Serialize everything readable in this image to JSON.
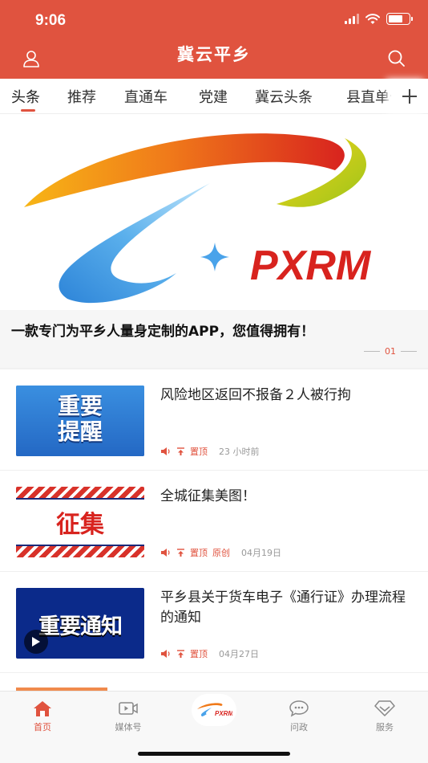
{
  "status": {
    "time": "9:06"
  },
  "header": {
    "title": "冀云平乡"
  },
  "tabs": [
    {
      "label": "头条"
    },
    {
      "label": "推荐"
    },
    {
      "label": "直通车"
    },
    {
      "label": "党建"
    },
    {
      "label": "冀云头条"
    },
    {
      "label": "县直单位"
    }
  ],
  "banner": {
    "logo_text": "PXRM",
    "caption": "一款专门为平乡人量身定制的APP，您值得拥有！",
    "page": "01"
  },
  "news": [
    {
      "thumb_text": [
        "重要",
        "提醒"
      ],
      "title": "风险地区返回不报备２人被行拘",
      "tags": [
        "置顶"
      ],
      "date": "23 小时前"
    },
    {
      "thumb_text": [
        "征集"
      ],
      "title": "全城征集美图！",
      "tags": [
        "置顶",
        "原创"
      ],
      "date": "04月19日"
    },
    {
      "thumb_text": [
        "重要通知"
      ],
      "title": "平乡县关于货车电子《通行证》办理流程的通知",
      "tags": [
        "置顶"
      ],
      "date": "04月27日"
    }
  ],
  "bottom_nav": [
    {
      "label": "首页",
      "icon": "home-icon",
      "active": true
    },
    {
      "label": "媒体号",
      "icon": "video-icon",
      "active": false
    },
    {
      "label": "问政",
      "icon": "chat-icon",
      "active": false
    },
    {
      "label": "服务",
      "icon": "diamond-icon",
      "active": false
    }
  ],
  "center_logo_text": "PXRM",
  "colors": {
    "brand": "#e0533f",
    "blue_thumb": "#2f7fd6",
    "navy_thumb": "#0b2a8a"
  }
}
